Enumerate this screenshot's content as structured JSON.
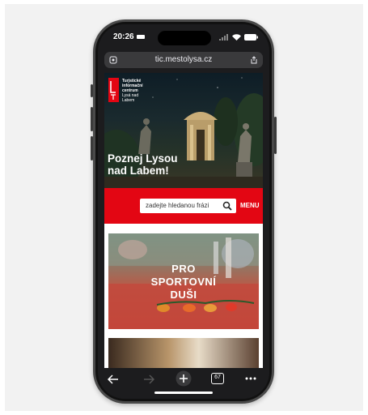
{
  "status_bar": {
    "time": "20:26"
  },
  "browser": {
    "url": "tic.mestolysa.cz",
    "tabs_count": "67"
  },
  "site": {
    "logo_text": [
      "Turistické",
      "informační",
      "centrum",
      "Lysá nad",
      "Labem"
    ],
    "hero_title_line1": "Poznej Lysou",
    "hero_title_line2": "nad Labem!",
    "search_placeholder": "zadejte hledanou frázi",
    "menu_label": "MENU",
    "card_title_line1": "PRO",
    "card_title_line2": "SPORTOVNÍ",
    "card_title_line3": "DUŠI"
  },
  "colors": {
    "brand_red": "#e30613",
    "browser_chrome": "#1c1c1e"
  },
  "icons": {
    "reader": "reader-icon",
    "share": "share-icon",
    "back": "back-arrow-icon",
    "forward": "forward-arrow-icon",
    "new_tab": "plus-icon",
    "tabs": "tabs-icon",
    "more": "more-icon",
    "search": "search-icon"
  }
}
